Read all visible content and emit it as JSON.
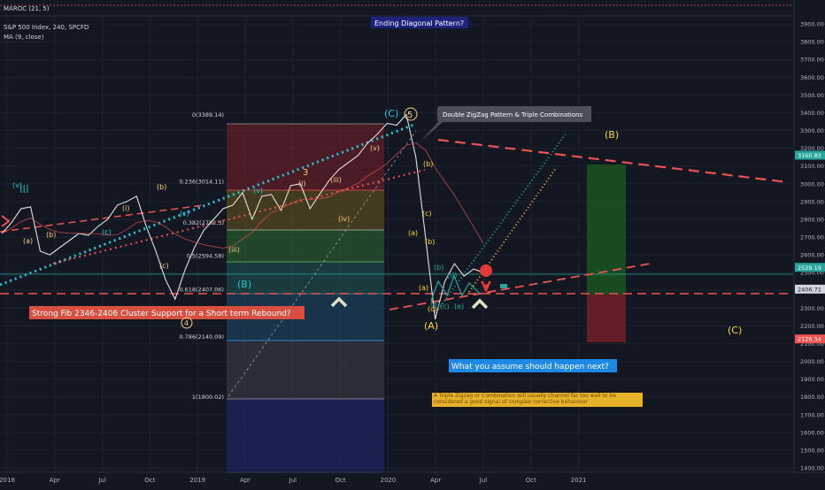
{
  "header": {
    "indicator_label": "MAROC (21, 5)",
    "indicator_value": "0.00",
    "symbol_label": "S&P 500 Index, 240, SPCFD",
    "ma_label": "MA (9, close)"
  },
  "chart_data": {
    "type": "line",
    "title": "S&P 500 Index, 240, SPCFD",
    "price_range": [
      1400,
      4000
    ],
    "x_tick_labels": [
      "2018",
      "Apr",
      "Jul",
      "Oct",
      "2019",
      "Apr",
      "Jul",
      "Oct",
      "2020",
      "Apr",
      "Jul",
      "Oct",
      "2021"
    ],
    "y_tick_labels": [
      "3900.00",
      "3800.00",
      "3700.00",
      "3600.00",
      "3500.00",
      "3400.00",
      "3300.00",
      "3200.00",
      "3100.00",
      "3000.00",
      "2900.00",
      "2800.00",
      "2700.00",
      "2600.00",
      "2500.00",
      "2400.00",
      "2300.00",
      "2200.00",
      "2100.00",
      "2000.00",
      "1900.00",
      "1800.00",
      "1700.00",
      "1600.00",
      "1500.00",
      "1400.00"
    ],
    "price_badges": [
      {
        "label": "3160.83",
        "value": 3160.83,
        "color": "#26a69a"
      },
      {
        "label": "2529.19",
        "value": 2529.19,
        "color": "#26a69a"
      },
      {
        "label": "2406.71",
        "value": 2406.71,
        "color": "#d1d4dc"
      },
      {
        "label": "2126.34",
        "value": 2126.34,
        "color": "#ef5350"
      }
    ],
    "fib_levels": [
      {
        "label": "0(3389.14)",
        "value": 3389.14
      },
      {
        "label": "0.236(3014.11)",
        "value": 3014.11
      },
      {
        "label": "0.382(2782.3)",
        "value": 2782.3
      },
      {
        "label": "0.5(2594.58)",
        "value": 2594.58
      },
      {
        "label": "0.618(2407.06)",
        "value": 2407.06
      },
      {
        "label": "0.786(2140.09)",
        "value": 2140.09
      },
      {
        "label": "1(1800.02)",
        "value": 1800.02
      }
    ],
    "series": [
      {
        "values": [
          2720,
          2780,
          2860,
          2870,
          2620,
          2600,
          2640,
          2680,
          2720,
          2710,
          2760,
          2800,
          2880,
          2900,
          2930,
          2760,
          2620,
          2460,
          2350,
          2510,
          2640,
          2740,
          2800,
          2860,
          2880,
          2950,
          2800,
          2930,
          2940,
          2850,
          2990,
          3000,
          2860,
          2940,
          3020,
          3080,
          3120,
          3160,
          3230,
          3280,
          3340,
          3330,
          3390,
          3150,
          2700,
          2237,
          2450,
          2550,
          2480,
          2520,
          2500
        ]
      }
    ]
  },
  "annotations": {
    "ending_diagonal": "Ending Diagonal Pattern?",
    "double_zigzag": "Double ZigZag Pattern  & Triple Combinations",
    "fib_support": "Strong Fib 2346-2406 Cluster Support for a Short term Rebound?",
    "question": "What you assume should happen next?",
    "triple_zigzag_note": "A Triple Zigzag or Combination will usually channel far too well to be considered a good signal of complex corrective behaviour",
    "wave_labels": {
      "c_big": "(C)",
      "five_circle": "5",
      "b_big": "(B)",
      "a_big": "(A)",
      "c_future": "(C)",
      "b_2019": "(B)",
      "iii_green": "III",
      "iv_circle": "4",
      "three": "3",
      "v": "(v)",
      "iii": "(iii)",
      "iv": "(iv)",
      "i": "(i)",
      "a": "(a)",
      "b": "(b)",
      "c": "(c)",
      "d": "(d)",
      "e": "(e)"
    }
  }
}
